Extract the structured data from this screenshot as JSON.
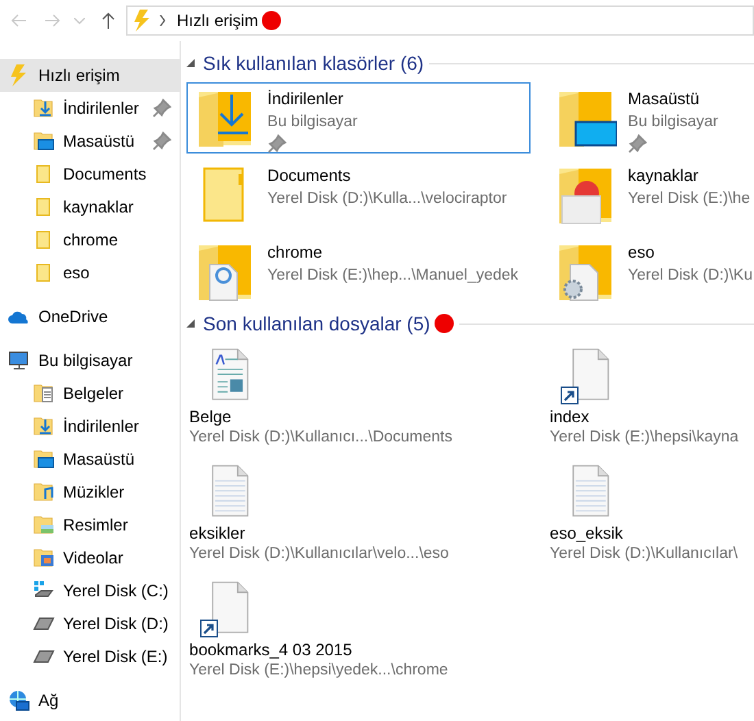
{
  "address_bar": {
    "path": "Hızlı erişim",
    "marked": true
  },
  "sidebar": {
    "items": [
      {
        "label": "Hızlı erişim",
        "kind": "quick",
        "selected": true,
        "children": [
          {
            "label": "İndirilenler",
            "kind": "downloads",
            "pinned": true,
            "selected": false
          },
          {
            "label": "Masaüstü",
            "kind": "desktop",
            "pinned": true,
            "selected": false
          },
          {
            "label": "Documents",
            "kind": "folder",
            "pinned": false,
            "selected": false
          },
          {
            "label": "kaynaklar",
            "kind": "folder",
            "pinned": false,
            "selected": false
          },
          {
            "label": "chrome",
            "kind": "folder",
            "pinned": false,
            "selected": false
          },
          {
            "label": "eso",
            "kind": "folder",
            "pinned": false,
            "selected": false
          }
        ]
      },
      {
        "label": "OneDrive",
        "kind": "cloud",
        "selected": false
      },
      {
        "label": "Bu bilgisayar",
        "kind": "pc",
        "selected": false,
        "children": [
          {
            "label": "Belgeler",
            "kind": "docs",
            "pinned": false,
            "selected": false
          },
          {
            "label": "İndirilenler",
            "kind": "downloads",
            "pinned": false,
            "selected": false
          },
          {
            "label": "Masaüstü",
            "kind": "desktop",
            "pinned": false,
            "selected": false
          },
          {
            "label": "Müzikler",
            "kind": "music",
            "pinned": false,
            "selected": false
          },
          {
            "label": "Resimler",
            "kind": "pictures",
            "pinned": false,
            "selected": false
          },
          {
            "label": "Videolar",
            "kind": "videos",
            "pinned": false,
            "selected": false
          },
          {
            "label": "Yerel Disk (C:)",
            "kind": "sysdrive",
            "pinned": false,
            "selected": false
          },
          {
            "label": "Yerel Disk (D:)",
            "kind": "drive",
            "pinned": false,
            "selected": false
          },
          {
            "label": "Yerel Disk (E:)",
            "kind": "drive",
            "pinned": false,
            "selected": false
          }
        ]
      },
      {
        "label": "Ağ",
        "kind": "network",
        "selected": false
      }
    ]
  },
  "sections": [
    {
      "title": "Sık kullanılan klasörler (6)",
      "expanded": true,
      "kind": "folders",
      "items": [
        {
          "name": "İndirilenler",
          "path": "Bu bilgisayar",
          "kind": "downloads",
          "pinned": true,
          "selected": true
        },
        {
          "name": "Masaüstü",
          "path": "Bu bilgisayar",
          "kind": "desktop",
          "pinned": true,
          "selected": false
        },
        {
          "name": "Documents",
          "path": "Yerel Disk (D:)\\Kulla...\\velociraptor",
          "kind": "folder",
          "pinned": false,
          "selected": false
        },
        {
          "name": "kaynaklar",
          "path": "Yerel Disk (E:)\\he",
          "kind": "thumbs",
          "pinned": false,
          "selected": false
        },
        {
          "name": "chrome",
          "path": "Yerel Disk (E:)\\hep...\\Manuel_yedek",
          "kind": "chrome",
          "pinned": false,
          "selected": false
        },
        {
          "name": "eso",
          "path": "Yerel Disk (D:)\\Ku",
          "kind": "gear",
          "pinned": false,
          "selected": false
        }
      ]
    },
    {
      "title": "Son kullanılan dosyalar (5)",
      "expanded": true,
      "marked": true,
      "kind": "files",
      "items": [
        {
          "name": "Belge",
          "path": "Yerel Disk (D:)\\Kullanıcı...\\Documents",
          "kind": "wordpad",
          "shortcut": false,
          "selected": false
        },
        {
          "name": "index",
          "path": "Yerel Disk (E:)\\hepsi\\kayna",
          "kind": "blank",
          "shortcut": true,
          "selected": false
        },
        {
          "name": "eksikler",
          "path": "Yerel Disk (D:)\\Kullanıcılar\\velo...\\eso",
          "kind": "text",
          "shortcut": false,
          "selected": false
        },
        {
          "name": "eso_eksik",
          "path": "Yerel Disk (D:)\\Kullanıcılar\\",
          "kind": "text",
          "shortcut": false,
          "selected": false
        },
        {
          "name": "bookmarks_4 03 2015",
          "path": "Yerel Disk (E:)\\hepsi\\yedek...\\chrome",
          "kind": "blank",
          "shortcut": true,
          "selected": false
        }
      ]
    }
  ]
}
